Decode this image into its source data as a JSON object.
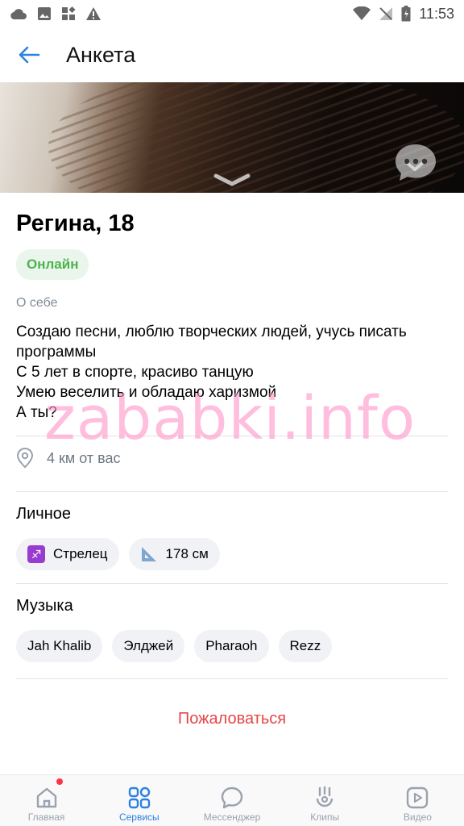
{
  "status_bar": {
    "time": "11:53",
    "left_icons": [
      "cloud-icon",
      "image-icon",
      "apps-icon",
      "warning-icon"
    ],
    "right_icons": [
      "wifi-icon",
      "no-signal-icon",
      "battery-icon"
    ]
  },
  "app_bar": {
    "title": "Анкета",
    "back_icon": "arrow-left-icon"
  },
  "profile": {
    "name_age": "Регина, 18",
    "status_badge": "Онлайн",
    "about_label": "О себе",
    "about_text": "Создаю песни, люблю творческих людей, учусь писать программы\nС 5 лет в спорте, красиво танцую\nУмею веселить и обладаю харизмой\nА ты?",
    "distance": "4 км от вас"
  },
  "personal": {
    "title": "Личное",
    "chips": [
      {
        "icon": "sagittarius-icon",
        "label": "Стрелец"
      },
      {
        "icon": "ruler-triangle-icon",
        "label": "178 см"
      }
    ]
  },
  "music": {
    "title": "Музыка",
    "chips": [
      "Jah Khalib",
      "Элджей",
      "Pharaoh",
      "Rezz"
    ]
  },
  "report_label": "Пожаловаться",
  "watermark": "zababki.info",
  "tab_bar": {
    "tabs": [
      {
        "label": "Главная",
        "icon": "home-icon"
      },
      {
        "label": "Сервисы",
        "icon": "services-icon"
      },
      {
        "label": "Мессенджер",
        "icon": "chat-icon"
      },
      {
        "label": "Клипы",
        "icon": "clips-icon"
      },
      {
        "label": "Видео",
        "icon": "video-icon"
      }
    ],
    "active_tab": "Сервисы"
  },
  "colors": {
    "accent": "#2d81e0",
    "online_green": "#4bb34b",
    "report_red": "#e64646",
    "muted": "#818c99"
  }
}
